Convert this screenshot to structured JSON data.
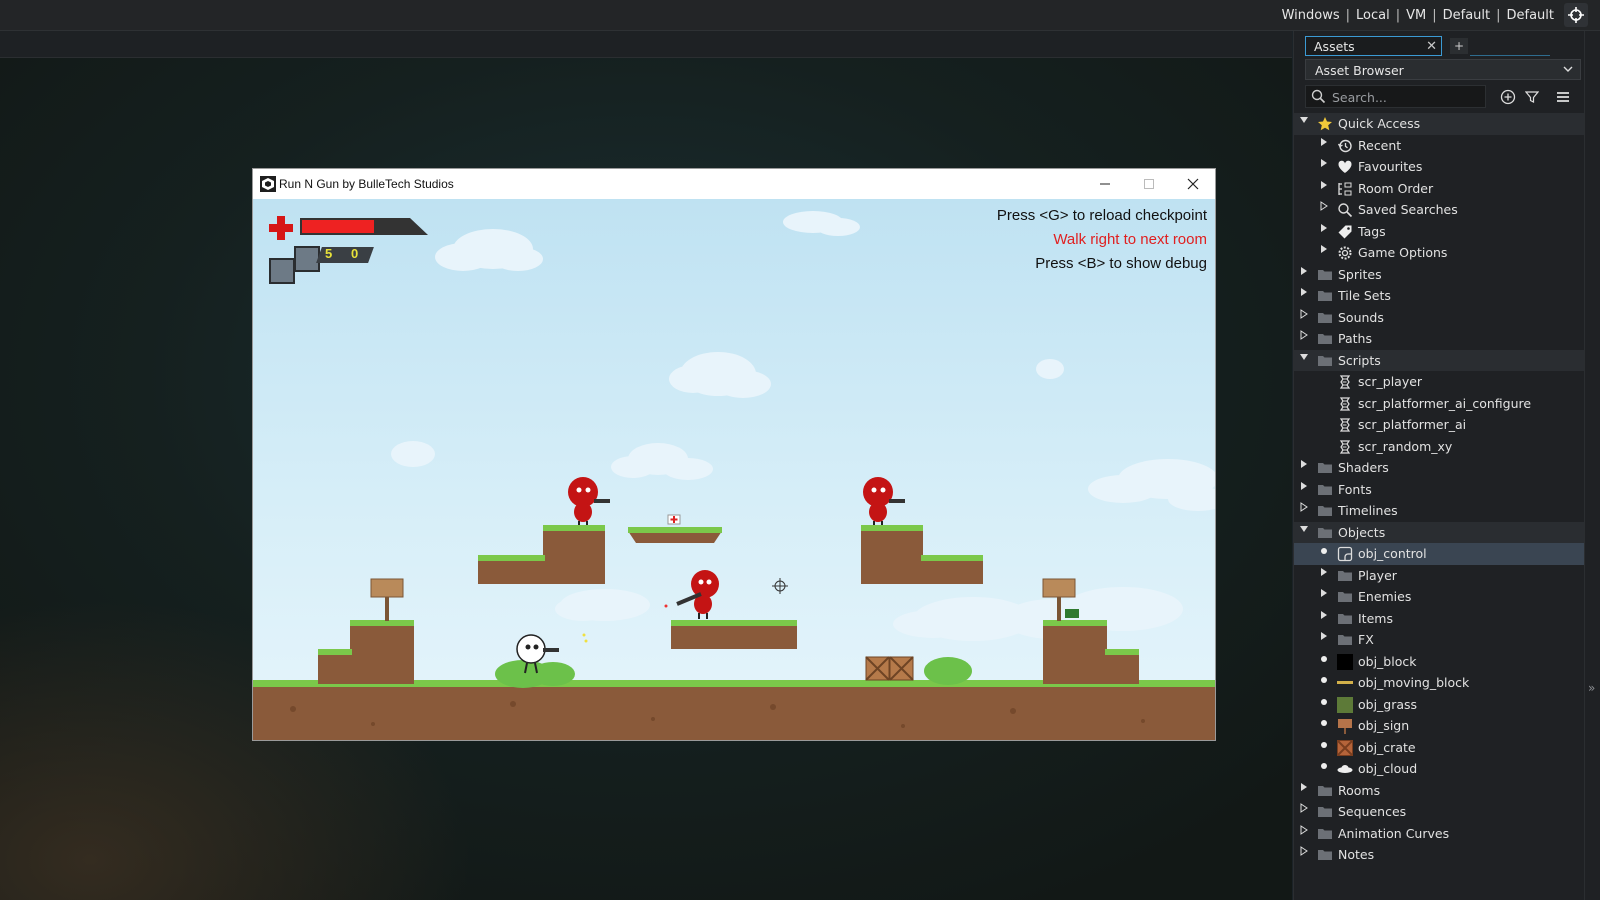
{
  "topbar": {
    "items": [
      "Windows",
      "Local",
      "VM",
      "Default",
      "Default"
    ],
    "target_icon": "crosshair-icon"
  },
  "assets": {
    "tab_label": "Assets",
    "browser_dropdown": "Asset Browser",
    "search_placeholder": "Search...",
    "tree": [
      {
        "label": "Quick Access",
        "expanded": true,
        "icon": "star-icon",
        "level": 0
      },
      {
        "label": "Recent",
        "icon": "history-icon",
        "level": 1
      },
      {
        "label": "Favourites",
        "icon": "heart-icon",
        "level": 1
      },
      {
        "label": "Room Order",
        "icon": "room-order-icon",
        "level": 1
      },
      {
        "label": "Saved Searches",
        "icon": "search-icon",
        "level": 1
      },
      {
        "label": "Tags",
        "icon": "tag-icon",
        "level": 1
      },
      {
        "label": "Game Options",
        "icon": "gear-icon",
        "level": 1
      },
      {
        "label": "Sprites",
        "icon": "folder-icon",
        "level": 0
      },
      {
        "label": "Tile Sets",
        "icon": "folder-icon",
        "level": 0
      },
      {
        "label": "Sounds",
        "icon": "folder-icon",
        "level": 0
      },
      {
        "label": "Paths",
        "icon": "folder-icon",
        "level": 0
      },
      {
        "label": "Scripts",
        "icon": "folder-icon",
        "level": 0,
        "expanded": true
      },
      {
        "label": "scr_player",
        "icon": "script-icon",
        "level": 1
      },
      {
        "label": "scr_platformer_ai_configure",
        "icon": "script-icon",
        "level": 1
      },
      {
        "label": "scr_platformer_ai",
        "icon": "script-icon",
        "level": 1
      },
      {
        "label": "scr_random_xy",
        "icon": "script-icon",
        "level": 1
      },
      {
        "label": "Shaders",
        "icon": "folder-icon",
        "level": 0
      },
      {
        "label": "Fonts",
        "icon": "folder-icon",
        "level": 0
      },
      {
        "label": "Timelines",
        "icon": "folder-icon",
        "level": 0
      },
      {
        "label": "Objects",
        "icon": "folder-icon",
        "level": 0,
        "expanded": true
      },
      {
        "label": "obj_control",
        "icon": "object-icon",
        "level": 1,
        "selected": true
      },
      {
        "label": "Player",
        "icon": "folder-icon",
        "level": 1
      },
      {
        "label": "Enemies",
        "icon": "folder-icon",
        "level": 1
      },
      {
        "label": "Items",
        "icon": "folder-icon",
        "level": 1
      },
      {
        "label": "FX",
        "icon": "folder-icon",
        "level": 1
      },
      {
        "label": "obj_block",
        "icon": "block-icon",
        "level": 1
      },
      {
        "label": "obj_moving_block",
        "icon": "moving-block-icon",
        "level": 1
      },
      {
        "label": "obj_grass",
        "icon": "grass-icon",
        "level": 1
      },
      {
        "label": "obj_sign",
        "icon": "sign-icon",
        "level": 1
      },
      {
        "label": "obj_crate",
        "icon": "crate-icon",
        "level": 1
      },
      {
        "label": "obj_cloud",
        "icon": "cloud-icon",
        "level": 1
      },
      {
        "label": "Rooms",
        "icon": "folder-icon",
        "level": 0
      },
      {
        "label": "Sequences",
        "icon": "folder-icon",
        "level": 0
      },
      {
        "label": "Animation Curves",
        "icon": "folder-icon",
        "level": 0
      },
      {
        "label": "Notes",
        "icon": "folder-icon",
        "level": 0
      }
    ]
  },
  "game_window": {
    "title": "Run N Gun by BulleTech Studios",
    "hud": {
      "line1": "Press <G> to reload checkpoint",
      "line2": "Walk right to next room",
      "line3": "Press <B> to show debug",
      "ammo_clip": "5",
      "ammo_reserve": "0",
      "health_fraction": 0.6
    }
  },
  "colors": {
    "accent": "#3b9ad4",
    "hint_red": "#e02020",
    "enemy_red": "#c41414"
  }
}
